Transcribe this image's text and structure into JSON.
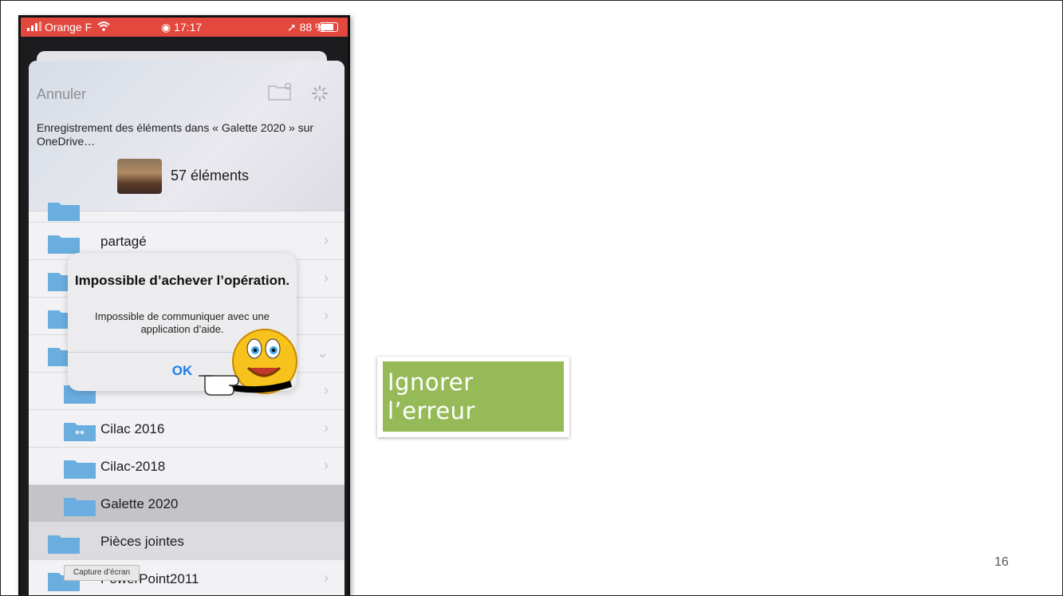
{
  "status_bar": {
    "carrier": "Orange F",
    "time": "17:17",
    "battery": "88 %"
  },
  "sheet": {
    "cancel_label": "Annuler",
    "saving_message": "Enregistrement des éléments dans « Galette 2020 » sur OneDrive…",
    "item_count": "57 éléments"
  },
  "folders": [
    {
      "label": "partagé"
    },
    {
      "label": "Cilac 2016"
    },
    {
      "label": "Cilac-2018"
    },
    {
      "label": "Galette 2020"
    },
    {
      "label": "Pièces jointes"
    },
    {
      "label": "PowerPoint2011"
    }
  ],
  "alert": {
    "title": "Impossible d’achever l’opération.",
    "message": "Impossible de communiquer avec une application d’aide.",
    "ok_label": "OK"
  },
  "tooltip": "Capture d’écran",
  "callout": "Ignorer l’erreur",
  "page_number": "16",
  "colors": {
    "status_bar": "#e2483d",
    "callout": "#97ba58",
    "alert_button": "#1a7cf0",
    "folder": "#6aaee0"
  },
  "icons": [
    "wifi-icon",
    "alarm-clock-icon",
    "location-arrow-icon",
    "battery-icon",
    "new-folder-icon",
    "spinner-icon",
    "folder-icon",
    "shared-folder-icon",
    "chevron-right-icon",
    "chevron-down-icon",
    "pointing-smiley"
  ]
}
